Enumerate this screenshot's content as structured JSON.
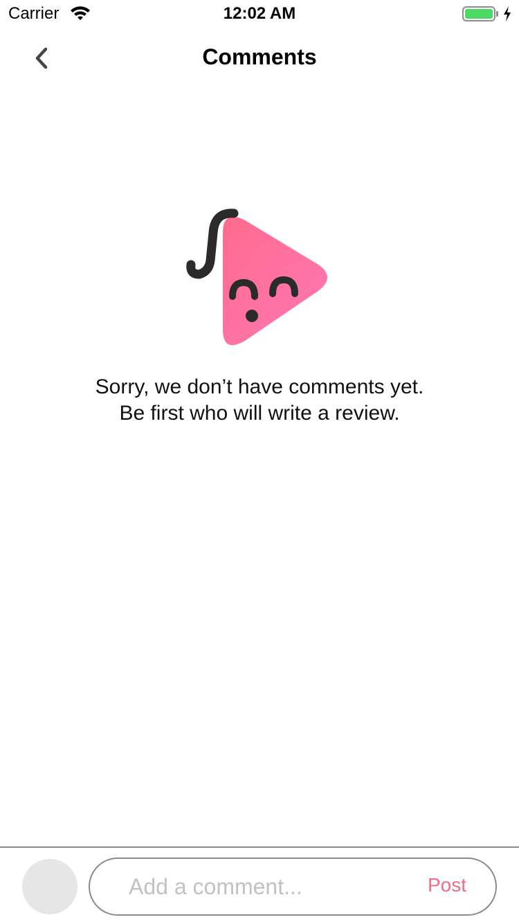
{
  "status_bar": {
    "carrier": "Carrier",
    "time": "12:02 AM",
    "wifi_icon": "wifi-icon",
    "battery_icon": "battery-full-icon",
    "charging_icon": "charging-bolt-icon",
    "battery_color": "#4cd964"
  },
  "nav": {
    "title": "Comments",
    "back_icon": "chevron-left-icon"
  },
  "empty_state": {
    "illustration": "sleepy-play-mascot-icon",
    "line1": "Sorry, we don’t have comments yet.",
    "line2": "Be first who will write a review."
  },
  "composer": {
    "avatar": "user-avatar-placeholder",
    "placeholder": "Add a comment...",
    "value": "",
    "post_label": "Post"
  },
  "colors": {
    "accent": "#f26b8a",
    "mascot_gradient_start": "#ff6b8e",
    "mascot_gradient_end": "#ff78b4",
    "border": "#8a8a8a",
    "placeholder": "#c2c2c2"
  }
}
